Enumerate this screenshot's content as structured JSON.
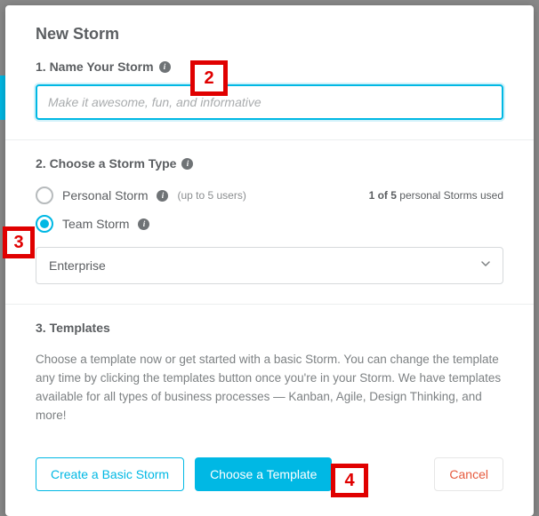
{
  "modal": {
    "title": "New Storm"
  },
  "section1": {
    "label": "1. Name Your Storm",
    "input_value": "",
    "input_placeholder": "Make it awesome, fun, and informative"
  },
  "section2": {
    "label": "2. Choose a Storm Type",
    "personal": {
      "label": "Personal Storm",
      "note": "(up to 5 users)",
      "usage_count": "1 of 5",
      "usage_suffix": " personal Storms used"
    },
    "team": {
      "label": "Team Storm"
    },
    "select_value": "Enterprise"
  },
  "section3": {
    "label": "3. Templates",
    "description": "Choose a template now or get started with a basic Storm. You can change the template any time by clicking the templates button once you're in your Storm. We have templates available for all types of business processes — Kanban, Agile, Design Thinking, and more!"
  },
  "footer": {
    "create_basic": "Create a Basic Storm",
    "choose_template": "Choose a Template",
    "cancel": "Cancel"
  },
  "callouts": {
    "c2": "2",
    "c3": "3",
    "c4": "4"
  }
}
